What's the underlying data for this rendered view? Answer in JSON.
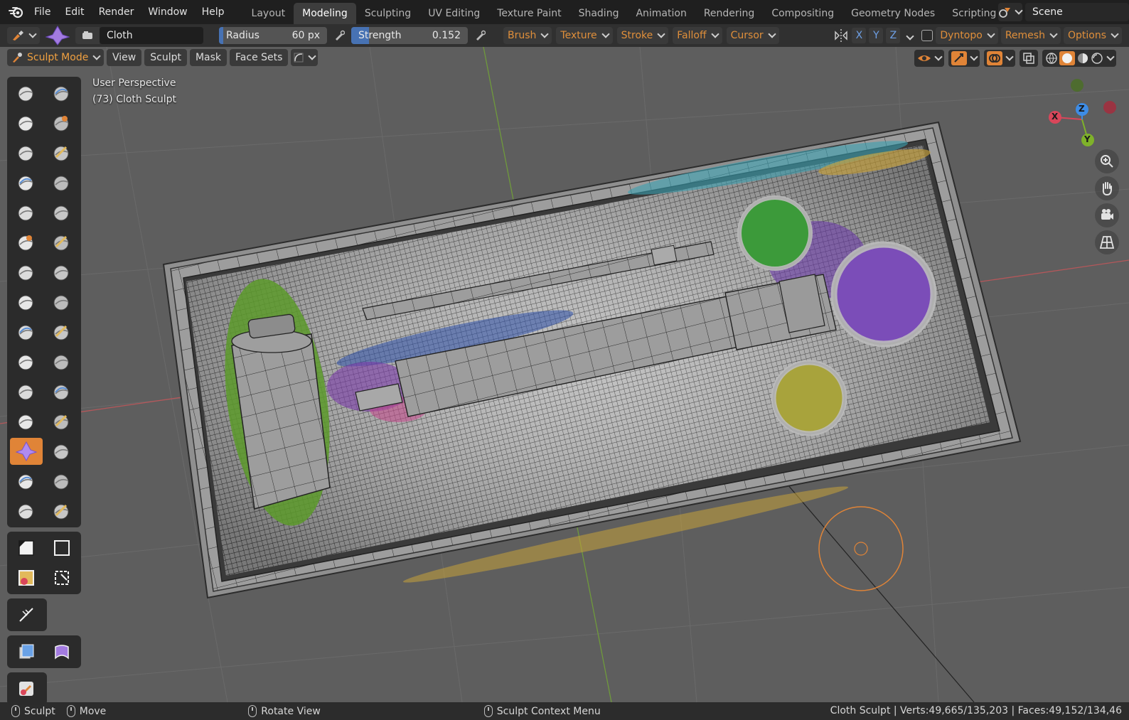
{
  "menu": {
    "items": [
      "File",
      "Edit",
      "Render",
      "Window",
      "Help"
    ]
  },
  "workspaces": {
    "tabs": [
      "Layout",
      "Modeling",
      "Sculpting",
      "UV Editing",
      "Texture Paint",
      "Shading",
      "Animation",
      "Rendering",
      "Compositing",
      "Geometry Nodes",
      "Scripting"
    ],
    "active": "Modeling",
    "add_label": "+"
  },
  "scene": {
    "name": "Scene"
  },
  "tool_header": {
    "brush_name": "Cloth",
    "radius_label": "Radius",
    "radius_value": "60 px",
    "strength_label": "Strength",
    "strength_value": "0.152",
    "strength_fraction": 0.152,
    "dropdowns": [
      "Brush",
      "Texture",
      "Stroke",
      "Falloff",
      "Cursor"
    ],
    "axes": [
      "X",
      "Y",
      "Z"
    ],
    "dyntopo": "Dyntopo",
    "remesh": "Remesh",
    "options": "Options"
  },
  "mode_bar": {
    "mode": "Sculpt Mode",
    "buttons": [
      "View",
      "Sculpt",
      "Mask",
      "Face Sets"
    ]
  },
  "viewport": {
    "perspective": "User Perspective",
    "object": "(73) Cloth Sculpt"
  },
  "gizmo": {
    "x": "X",
    "y": "Y",
    "z": "Z"
  },
  "toolbar": {
    "tools": [
      "draw-brush",
      "draw-sharp-brush",
      "clay-brush",
      "clay-strips-brush",
      "clay-thumb-brush",
      "layer-brush",
      "inflate-brush",
      "blob-brush",
      "crease-brush",
      "smooth-brush",
      "flatten-brush",
      "fill-brush",
      "scrape-brush",
      "multiplane-scrape-brush",
      "pinch-brush",
      "grab-brush",
      "elastic-deform-brush",
      "snake-hook-brush",
      "thumb-brush",
      "pose-brush",
      "nudge-brush",
      "rotate-brush",
      "slide-relax-brush",
      "boundary-brush",
      "cloth-brush",
      "simplify-brush",
      "mask-brush",
      "draw-face-sets-brush",
      "multires-displacement-eraser",
      "multires-displacement-smear"
    ],
    "active_tool": "cloth-brush"
  },
  "status_bar": {
    "left": [
      {
        "label": "Sculpt"
      },
      {
        "label": "Move"
      },
      {
        "label": "Rotate View"
      },
      {
        "label": "Sculpt Context Menu"
      }
    ],
    "right": "Cloth Sculpt | Verts:49,665/135,203 | Faces:49,152/134,46"
  },
  "colors": {
    "accent": "#e08437",
    "active_slider": "#4772b3",
    "viewport_bg": "#5e5e5e",
    "x_axis": "#d9465a",
    "y_axis": "#7fb22a",
    "z_axis": "#3d8ce6"
  }
}
